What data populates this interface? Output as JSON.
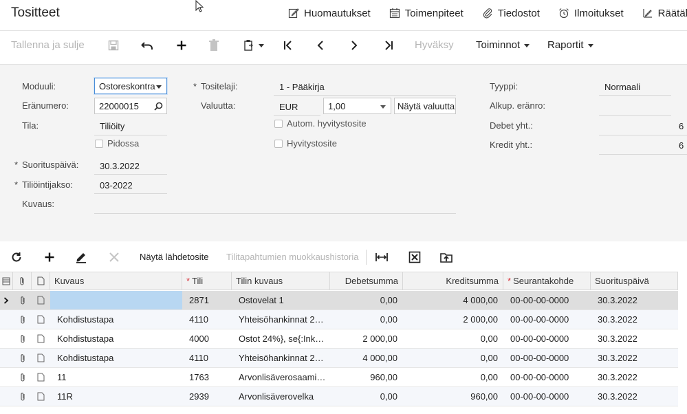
{
  "page": {
    "title": "Tositteet"
  },
  "top_actions": [
    {
      "label": "Huomautukset",
      "icon": "note-edit-icon"
    },
    {
      "label": "Toimenpiteet",
      "icon": "calendar-icon"
    },
    {
      "label": "Tiedostot",
      "icon": "paperclip-icon"
    },
    {
      "label": "Ilmoitukset",
      "icon": "alarm-clock-icon"
    },
    {
      "label": "Räätälö",
      "icon": "customize-icon"
    }
  ],
  "toolbar": {
    "save_close": "Tallenna ja sulje",
    "approve": "Hyväksy",
    "actions": "Toiminnot",
    "reports": "Raportit"
  },
  "form": {
    "module_label": "Moduuli:",
    "module_value": "Ostoreskontra",
    "batch_label": "Eränumero:",
    "batch_value": "22000015",
    "status_label": "Tila:",
    "status_value": "Tiliöity",
    "hold_label": "Pidossa",
    "payment_date_label": "Suorituspäivä:",
    "payment_date_value": "30.3.2022",
    "period_label": "Tiliöintijakso:",
    "period_value": "03-2022",
    "desc_label": "Kuvaus:",
    "desc_value": "",
    "ledger_label": "Tositelaji:",
    "ledger_value": "1 - Pääkirja",
    "currency_label": "Valuutta:",
    "currency_value": "EUR",
    "rate_value": "1,00",
    "show_currency_button": "Näytä valuutta",
    "auto_reversing_label": "Autom. hyvitystosite",
    "reversing_label": "Hyvitystosite",
    "type_label": "Tyyppi:",
    "type_value": "Normaali",
    "orig_batch_label": "Alkup. eränro:",
    "orig_batch_value": "",
    "debit_total_label": "Debet yht.:",
    "debit_total_value": "6",
    "credit_total_label": "Kredit yht.:",
    "credit_total_value": "6"
  },
  "grid_toolbar": {
    "view_source": "Näytä lähdetosite",
    "edit_history": "Tilitapahtumien muokkaushistoria"
  },
  "columns": {
    "kuvaus": "Kuvaus",
    "tili": "Tili",
    "tilin_kuvaus": "Tilin kuvaus",
    "debet": "Debetsumma",
    "kredit": "Kreditsumma",
    "seuranta": "Seurantakohde",
    "suorituspaiva": "Suorituspäivä"
  },
  "rows": [
    {
      "kuvaus": "",
      "tili": "2871",
      "tilin_kuvaus": "Ostovelat 1",
      "debet": "0,00",
      "kredit": "4 000,00",
      "seuranta": "00-00-00-0000",
      "pvm": "30.3.2022"
    },
    {
      "kuvaus": "Kohdistustapa",
      "tili": "4110",
      "tilin_kuvaus": "Yhteisöhankinnat 2…",
      "debet": "0,00",
      "kredit": "2 000,00",
      "seuranta": "00-00-00-0000",
      "pvm": "30.3.2022"
    },
    {
      "kuvaus": "Kohdistustapa",
      "tili": "4000",
      "tilin_kuvaus": "Ostot 24%}, se{:Ink…",
      "debet": "2 000,00",
      "kredit": "0,00",
      "seuranta": "00-00-00-0000",
      "pvm": "30.3.2022"
    },
    {
      "kuvaus": "Kohdistustapa",
      "tili": "4110",
      "tilin_kuvaus": "Yhteisöhankinnat 2…",
      "debet": "4 000,00",
      "kredit": "0,00",
      "seuranta": "00-00-00-0000",
      "pvm": "30.3.2022"
    },
    {
      "kuvaus": "11",
      "tili": "1763",
      "tilin_kuvaus": "Arvonlisäverosaami…",
      "debet": "960,00",
      "kredit": "0,00",
      "seuranta": "00-00-00-0000",
      "pvm": "30.3.2022"
    },
    {
      "kuvaus": "11R",
      "tili": "2939",
      "tilin_kuvaus": "Arvonlisäverovelka",
      "debet": "0,00",
      "kredit": "960,00",
      "seuranta": "00-00-00-0000",
      "pvm": "30.3.2022"
    }
  ]
}
